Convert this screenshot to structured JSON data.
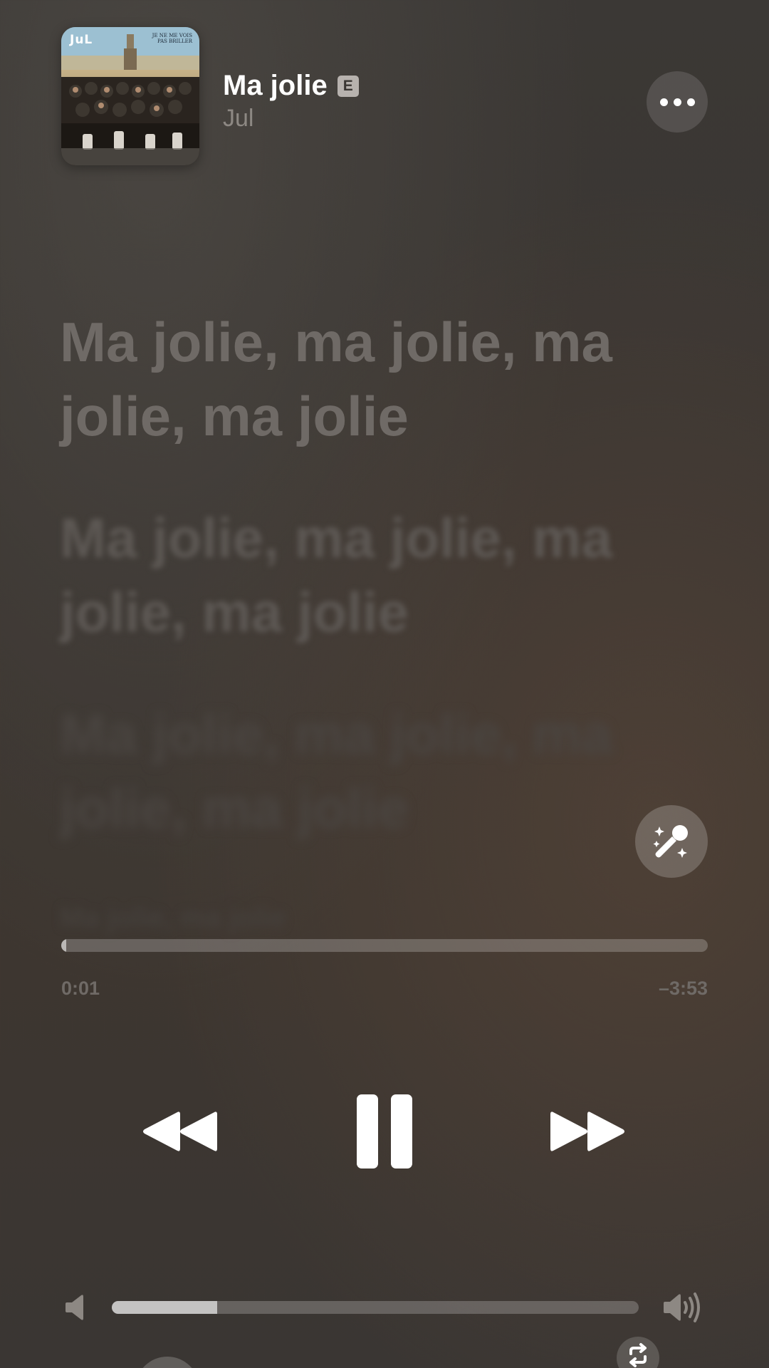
{
  "now_playing": {
    "title": "Ma jolie",
    "explicit_badge": "E",
    "artist": "Jul",
    "album_art": {
      "logo_text": "JuL",
      "subtitle_text": "JE NE ME VOIS PAS BRILLER"
    },
    "more_icon": "ellipsis-icon"
  },
  "lyrics": {
    "lines": [
      "Ma jolie, ma jolie, ma jolie, ma jolie",
      "Ma jolie, ma jolie, ma jolie, ma jolie",
      "Ma jolie, ma jolie, ma jolie, ma jolie",
      "Ma jolie, ma jolie"
    ],
    "sing_icon": "microphone-sparkles-icon"
  },
  "playback": {
    "elapsed": "0:01",
    "remaining": "–3:53",
    "progress_fraction": 0.004
  },
  "controls": {
    "rewind_icon": "rewind-icon",
    "pause_icon": "pause-icon",
    "forward_icon": "fast-forward-icon",
    "repeat_icon": "repeat-icon"
  },
  "volume": {
    "level_fraction": 0.2,
    "low_icon": "speaker-low-icon",
    "high_icon": "speaker-high-icon"
  },
  "colors": {
    "background": "#3a3633",
    "text_primary": "#ffffff",
    "text_secondary": "#8d8883",
    "lyric_active": "#6f6a66"
  }
}
